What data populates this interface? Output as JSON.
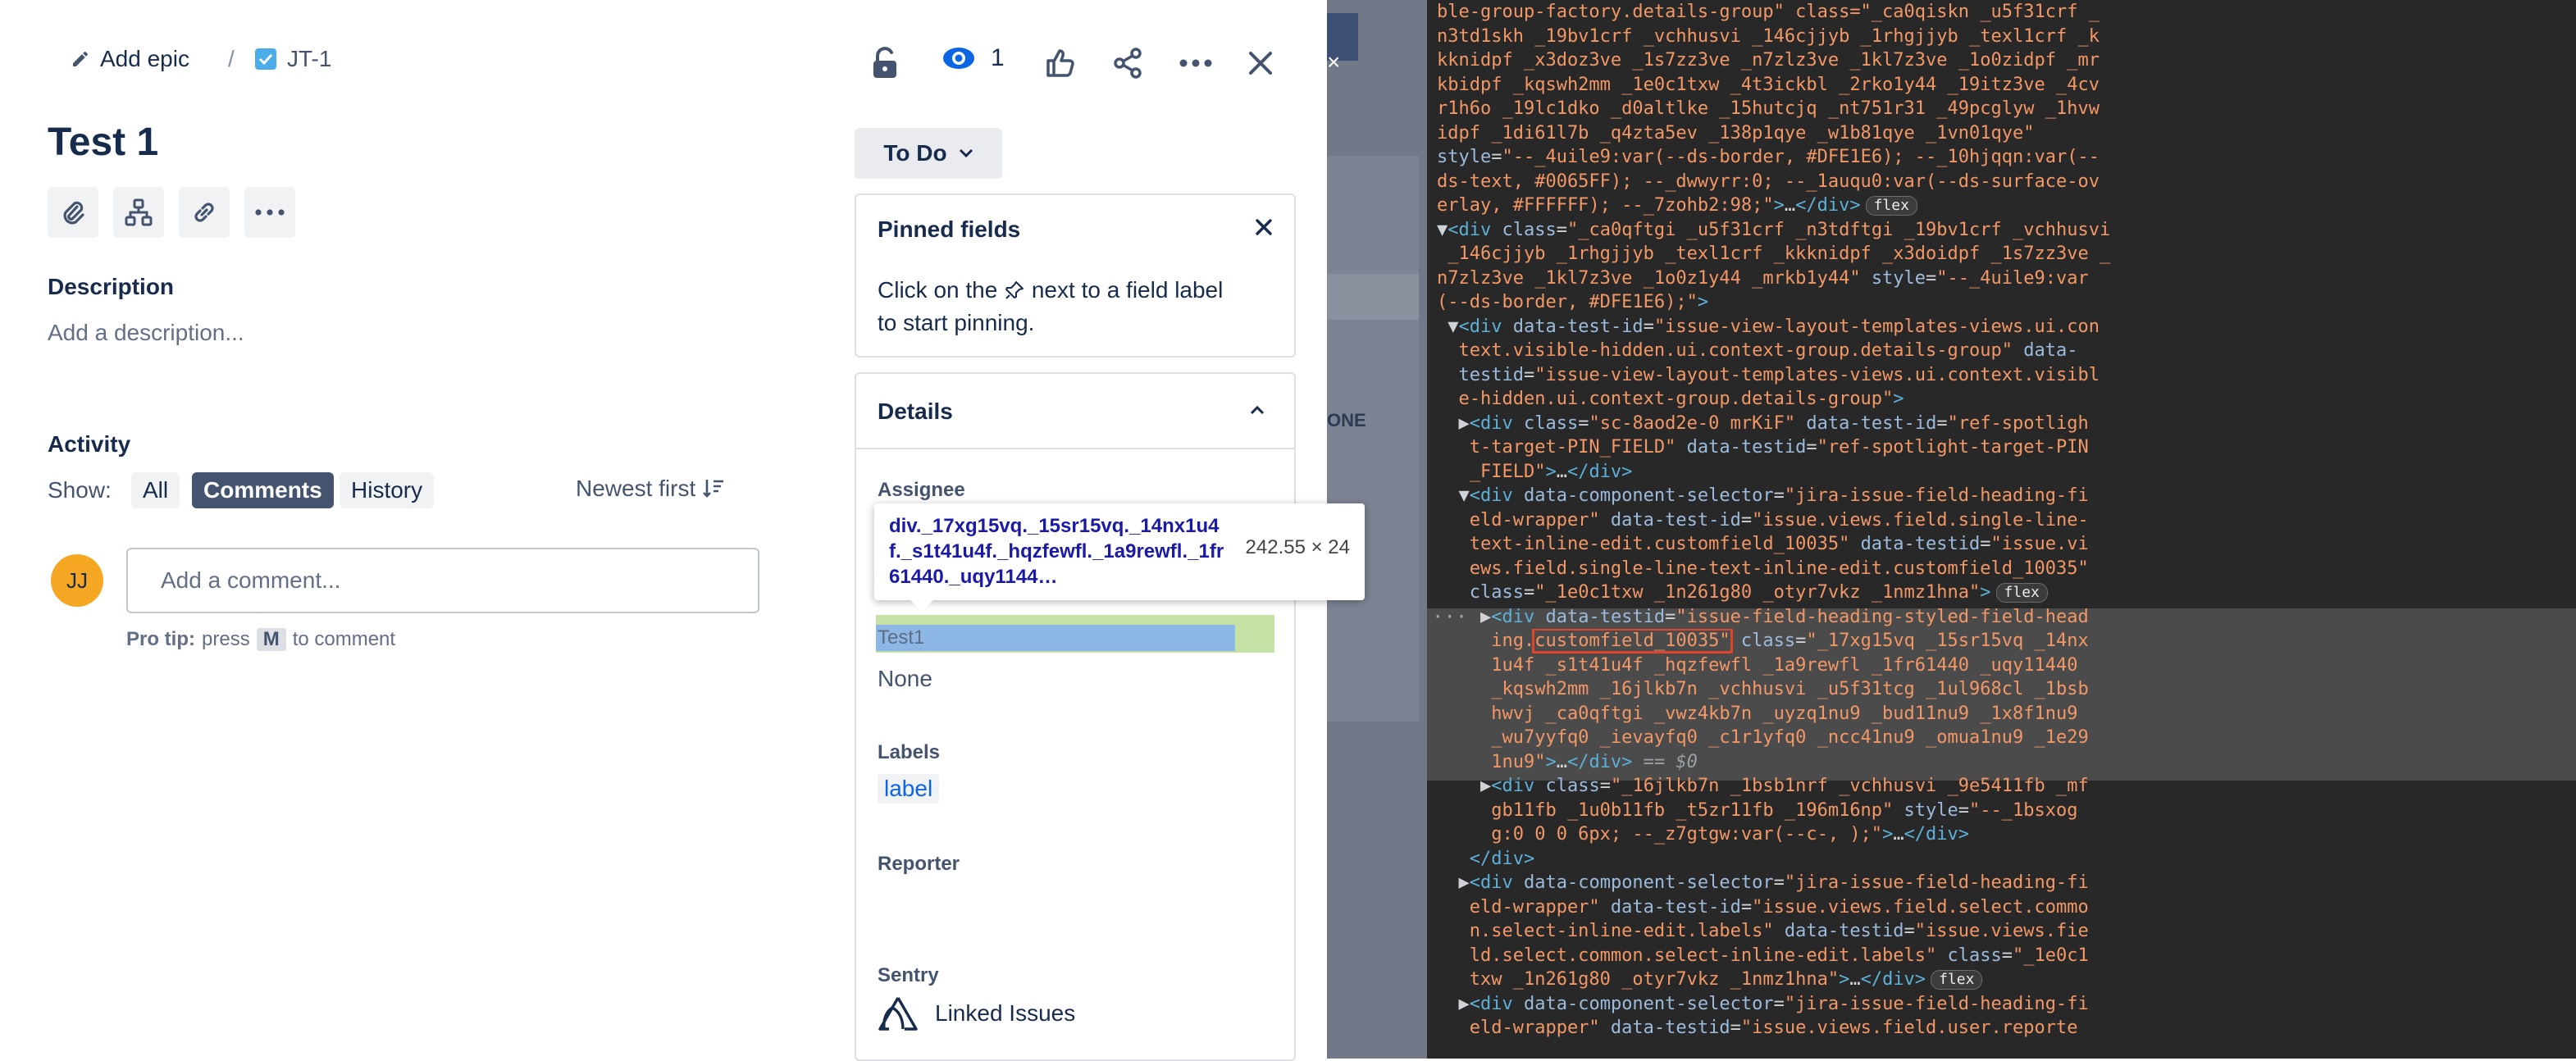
{
  "issue": {
    "breadcrumb": {
      "add_epic_label": "Add epic",
      "separator": "/",
      "issue_key": "JT-1"
    },
    "header_actions": {
      "watch_count": "1"
    },
    "title": "Test 1",
    "status_button": {
      "label": "To Do"
    },
    "description": {
      "heading": "Description",
      "placeholder": "Add a description..."
    },
    "activity": {
      "heading": "Activity",
      "show_label": "Show:",
      "filters": [
        "All",
        "Comments",
        "History"
      ],
      "sort_label": "Newest first"
    },
    "comment": {
      "avatar_initials": "JJ",
      "placeholder": "Add a comment...",
      "pro_tip_prefix": "Pro tip:",
      "pro_tip_press": "press",
      "pro_tip_key": "M",
      "pro_tip_suffix": "to comment"
    },
    "pinned_fields": {
      "heading": "Pinned fields",
      "text_before": "Click on the",
      "text_after": "next to a field label",
      "text_line2": "to start pinning."
    },
    "details": {
      "heading": "Details",
      "assignee_label": "Assignee",
      "custom_field_value": "Test1",
      "none_value": "None",
      "labels_label": "Labels",
      "label_value": "label",
      "reporter_label": "Reporter",
      "sentry_label": "Sentry",
      "linked_issues_label": "Linked Issues"
    },
    "inspect_tooltip": {
      "selector": "div._17xg15vq._15sr15vq._14nx1u4f._s1t41u4f._hqzfewfl._1a9rewfl._1fr61440._uqy1144…",
      "size": "242.55 × 24"
    }
  },
  "background_fragments": {
    "none_fragment": "ONE"
  },
  "colors": {
    "accent_blue": "#0c66e4",
    "status_button_bg": "#e9ebee",
    "devtools_bg": "#282828",
    "devtools_selected_bg": "#4b4b4b",
    "inspect_highlight_green": "#c5e1a5",
    "inspect_highlight_blue": "#8db8e6",
    "avatar_orange": "#f5a623",
    "tooltip_selector_purple": "#881280",
    "tooltip_selector_blue": "#1a1aa6"
  },
  "devtools": {
    "lines": [
      [
        {
          "t": "val",
          "v": "ble-group-factory.details-group\" class=\"_ca0qiskn _u5f31crf _"
        }
      ],
      [
        {
          "t": "val",
          "v": "n3td1skh _19bv1crf _vchhusvi _146cjjyb _1rhgjjyb _texl1crf _k"
        }
      ],
      [
        {
          "t": "val",
          "v": "kknidpf _x3doz3ve _1s7zz3ve _n7zlz3ve _1kl7z3ve _1o0zidpf _mr"
        }
      ],
      [
        {
          "t": "val",
          "v": "kbidpf _kqswh2mm _1e0c1txw _4t3ickbl _2rko1y44 _19itz3ve _4cv"
        }
      ],
      [
        {
          "t": "val",
          "v": "r1h6o _19lc1dko _d0altlke _15hutcjq _nt751r31 _49pcglyw _1hvw"
        }
      ],
      [
        {
          "t": "val",
          "v": "idpf _1di61l7b _q4zta5ev _138p1qye _w1b81qye _1vn01qye\""
        }
      ],
      [
        {
          "t": "attr",
          "v": "style"
        },
        {
          "t": "plain",
          "v": "="
        },
        {
          "t": "val",
          "v": "\"--_4uile9:var(--ds-border, #DFE1E6); --_10hjqqn:var(--"
        }
      ],
      [
        {
          "t": "val",
          "v": "ds-text, #0065FF); --_dwwyrr:0; --_1auqu0:var(--ds-surface-ov"
        }
      ],
      [
        {
          "t": "val",
          "v": "erlay, #FFFFFF); --_7zohb2:98;\""
        },
        {
          "t": "tag",
          "v": ">"
        },
        {
          "t": "plain",
          "v": "…"
        },
        {
          "t": "tag",
          "v": "</div>"
        },
        {
          "t": "badge",
          "v": "flex"
        }
      ],
      [
        {
          "t": "plain",
          "v": "▼"
        },
        {
          "t": "tag",
          "v": "<div "
        },
        {
          "t": "attr",
          "v": "class"
        },
        {
          "t": "plain",
          "v": "="
        },
        {
          "t": "val",
          "v": "\"_ca0qftgi _u5f31crf _n3tdftgi _19bv1crf _vchhusvi"
        }
      ],
      [
        {
          "t": "val",
          "v": " _146cjjyb _1rhgjjyb _texl1crf _kkknidpf _x3doidpf _1s7zz3ve _"
        }
      ],
      [
        {
          "t": "val",
          "v": "n7zlz3ve _1kl7z3ve _1o0z1y44 _mrkb1y44\" "
        },
        {
          "t": "attr",
          "v": "style"
        },
        {
          "t": "plain",
          "v": "="
        },
        {
          "t": "val",
          "v": "\"--_4uile9:var"
        }
      ],
      [
        {
          "t": "val",
          "v": "(--ds-border, #DFE1E6);\""
        },
        {
          "t": "tag",
          "v": ">"
        }
      ],
      [
        {
          "t": "plain",
          "v": " ▼"
        },
        {
          "t": "tag",
          "v": "<div "
        },
        {
          "t": "attr",
          "v": "data-test-id"
        },
        {
          "t": "plain",
          "v": "="
        },
        {
          "t": "val",
          "v": "\"issue-view-layout-templates-views.ui.con"
        }
      ],
      [
        {
          "t": "val",
          "v": "  text.visible-hidden.ui.context-group.details-group\" "
        },
        {
          "t": "attr",
          "v": "data-"
        }
      ],
      [
        {
          "t": "attr",
          "v": "  testid"
        },
        {
          "t": "plain",
          "v": "="
        },
        {
          "t": "val",
          "v": "\"issue-view-layout-templates-views.ui.context.visibl"
        }
      ],
      [
        {
          "t": "val",
          "v": "  e-hidden.ui.context-group.details-group\""
        },
        {
          "t": "tag",
          "v": ">"
        }
      ],
      [
        {
          "t": "plain",
          "v": "  ▶"
        },
        {
          "t": "tag",
          "v": "<div "
        },
        {
          "t": "attr",
          "v": "class"
        },
        {
          "t": "plain",
          "v": "="
        },
        {
          "t": "val",
          "v": "\"sc-8aod2e-0 mrKiF\" "
        },
        {
          "t": "attr",
          "v": "data-test-id"
        },
        {
          "t": "plain",
          "v": "="
        },
        {
          "t": "val",
          "v": "\"ref-spotligh"
        }
      ],
      [
        {
          "t": "val",
          "v": "   t-target-PIN_FIELD\" "
        },
        {
          "t": "attr",
          "v": "data-testid"
        },
        {
          "t": "plain",
          "v": "="
        },
        {
          "t": "val",
          "v": "\"ref-spotlight-target-PIN"
        }
      ],
      [
        {
          "t": "val",
          "v": "   _FIELD\""
        },
        {
          "t": "tag",
          "v": ">"
        },
        {
          "t": "plain",
          "v": "…"
        },
        {
          "t": "tag",
          "v": "</div>"
        }
      ],
      [
        {
          "t": "plain",
          "v": "  ▼"
        },
        {
          "t": "tag",
          "v": "<div "
        },
        {
          "t": "attr",
          "v": "data-component-selector"
        },
        {
          "t": "plain",
          "v": "="
        },
        {
          "t": "val",
          "v": "\"jira-issue-field-heading-fi"
        }
      ],
      [
        {
          "t": "val",
          "v": "   eld-wrapper\" "
        },
        {
          "t": "attr",
          "v": "data-test-id"
        },
        {
          "t": "plain",
          "v": "="
        },
        {
          "t": "val",
          "v": "\"issue.views.field.single-line-"
        }
      ],
      [
        {
          "t": "val",
          "v": "   text-inline-edit.customfield_10035\" "
        },
        {
          "t": "attr",
          "v": "data-testid"
        },
        {
          "t": "plain",
          "v": "="
        },
        {
          "t": "val",
          "v": "\"issue.vi"
        }
      ],
      [
        {
          "t": "val",
          "v": "   ews.field.single-line-text-inline-edit.customfield_10035\""
        }
      ],
      [
        {
          "t": "attr",
          "v": "   class"
        },
        {
          "t": "plain",
          "v": "="
        },
        {
          "t": "val",
          "v": "\"_1e0c1txw _1n261g80 _otyr7vkz _1nmz1hna\""
        },
        {
          "t": "tag",
          "v": ">"
        },
        {
          "t": "badge",
          "v": "flex"
        }
      ],
      [
        {
          "t": "plain",
          "v": "    ▶"
        },
        {
          "t": "tag",
          "v": "<div "
        },
        {
          "t": "attr",
          "v": "data-testid"
        },
        {
          "t": "plain",
          "v": "="
        },
        {
          "t": "val",
          "v": "\"issue-field-heading-styled-field-head"
        }
      ],
      [
        {
          "t": "val",
          "v": "     ing."
        },
        {
          "t": "hl",
          "v": "customfield_10035\""
        },
        {
          "t": "plain",
          "v": " "
        },
        {
          "t": "attr",
          "v": "class"
        },
        {
          "t": "plain",
          "v": "="
        },
        {
          "t": "val",
          "v": "\"_17xg15vq _15sr15vq _14nx"
        }
      ],
      [
        {
          "t": "val",
          "v": "     1u4f _s1t41u4f _hqzfewfl _1a9rewfl _1fr61440 _uqy11440"
        }
      ],
      [
        {
          "t": "val",
          "v": "     _kqswh2mm _16jlkb7n _vchhusvi _u5f31tcg _1ul968cl _1bsb"
        }
      ],
      [
        {
          "t": "val",
          "v": "     hwvj _ca0qftgi _vwz4kb7n _uyzq1nu9 _bud11nu9 _1x8f1nu9"
        }
      ],
      [
        {
          "t": "val",
          "v": "     _wu7yyfq0 _ievayfq0 _c1r1yfq0 _ncc41nu9 _omua1nu9 _1e29"
        }
      ],
      [
        {
          "t": "val",
          "v": "     1nu9\""
        },
        {
          "t": "tag",
          "v": ">"
        },
        {
          "t": "plain",
          "v": "…"
        },
        {
          "t": "tag",
          "v": "</div>"
        },
        {
          "t": "sel",
          "v": " == $0"
        }
      ],
      [
        {
          "t": "plain",
          "v": "    ▶"
        },
        {
          "t": "tag",
          "v": "<div "
        },
        {
          "t": "attr",
          "v": "class"
        },
        {
          "t": "plain",
          "v": "="
        },
        {
          "t": "val",
          "v": "\"_16jlkb7n _1bsb1nrf _vchhusvi _9e5411fb _mf"
        }
      ],
      [
        {
          "t": "val",
          "v": "     gb11fb _1u0b11fb _t5zr11fb _196m16np\" "
        },
        {
          "t": "attr",
          "v": "style"
        },
        {
          "t": "plain",
          "v": "="
        },
        {
          "t": "val",
          "v": "\"--_1bsxog"
        }
      ],
      [
        {
          "t": "val",
          "v": "     g:0 0 0 6px; --_z7gtgw:var(--c-, );\""
        },
        {
          "t": "tag",
          "v": ">"
        },
        {
          "t": "plain",
          "v": "…"
        },
        {
          "t": "tag",
          "v": "</div>"
        }
      ],
      [
        {
          "t": "tag",
          "v": "   </div>"
        }
      ],
      [
        {
          "t": "plain",
          "v": "  ▶"
        },
        {
          "t": "tag",
          "v": "<div "
        },
        {
          "t": "attr",
          "v": "data-component-selector"
        },
        {
          "t": "plain",
          "v": "="
        },
        {
          "t": "val",
          "v": "\"jira-issue-field-heading-fi"
        }
      ],
      [
        {
          "t": "val",
          "v": "   eld-wrapper\" "
        },
        {
          "t": "attr",
          "v": "data-test-id"
        },
        {
          "t": "plain",
          "v": "="
        },
        {
          "t": "val",
          "v": "\"issue.views.field.select.commo"
        }
      ],
      [
        {
          "t": "val",
          "v": "   n.select-inline-edit.labels\" "
        },
        {
          "t": "attr",
          "v": "data-testid"
        },
        {
          "t": "plain",
          "v": "="
        },
        {
          "t": "val",
          "v": "\"issue.views.fie"
        }
      ],
      [
        {
          "t": "val",
          "v": "   ld.select.common.select-inline-edit.labels\" "
        },
        {
          "t": "attr",
          "v": "class"
        },
        {
          "t": "plain",
          "v": "="
        },
        {
          "t": "val",
          "v": "\"_1e0c1"
        }
      ],
      [
        {
          "t": "val",
          "v": "   txw _1n261g80 _otyr7vkz _1nmz1hna\""
        },
        {
          "t": "tag",
          "v": ">"
        },
        {
          "t": "plain",
          "v": "…"
        },
        {
          "t": "tag",
          "v": "</div>"
        },
        {
          "t": "badge",
          "v": "flex"
        }
      ],
      [
        {
          "t": "plain",
          "v": "  ▶"
        },
        {
          "t": "tag",
          "v": "<div "
        },
        {
          "t": "attr",
          "v": "data-component-selector"
        },
        {
          "t": "plain",
          "v": "="
        },
        {
          "t": "val",
          "v": "\"jira-issue-field-heading-fi"
        }
      ],
      [
        {
          "t": "val",
          "v": "   eld-wrapper\" "
        },
        {
          "t": "attr",
          "v": "data-testid"
        },
        {
          "t": "plain",
          "v": "="
        },
        {
          "t": "val",
          "v": "\"issue.views.field.user.reporte"
        }
      ]
    ]
  }
}
